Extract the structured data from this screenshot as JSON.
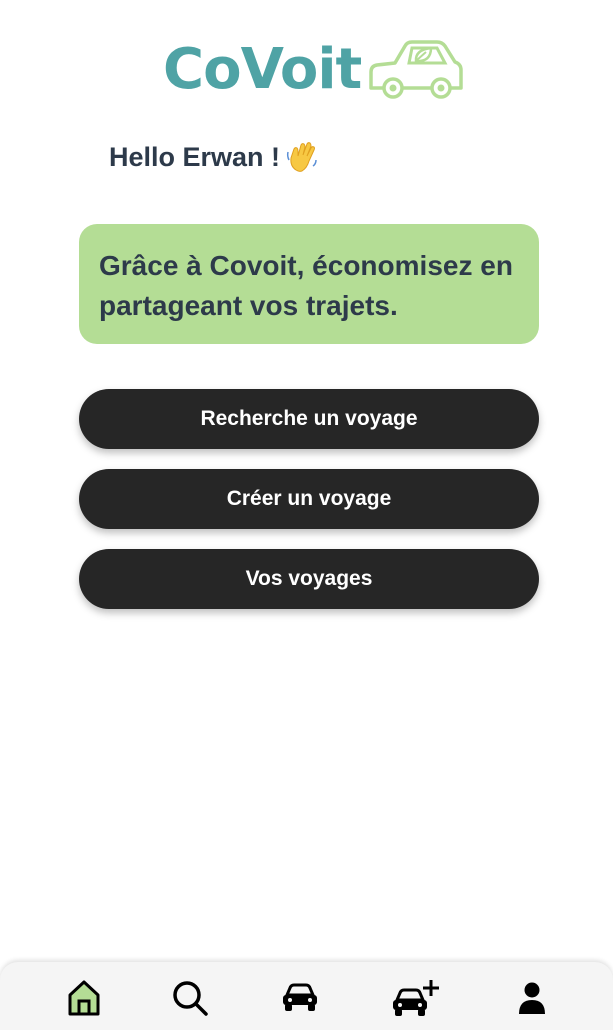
{
  "app": {
    "logo_text": "CoVoit",
    "brand_color": "#4fa3a5",
    "logo_car_color": "#b4dd95"
  },
  "greeting": {
    "text": "Hello Erwan !",
    "icon": "waving-hand-icon"
  },
  "promo": {
    "text": "Grâce à Covoit, économisez en partageant vos trajets.",
    "background": "#b4dd95"
  },
  "actions": {
    "search_trip": "Recherche un voyage",
    "create_trip": "Créer un voyage",
    "my_trips": "Vos voyages"
  },
  "bottom_nav": {
    "items": [
      {
        "icon": "home-icon",
        "active": true
      },
      {
        "icon": "search-icon",
        "active": false
      },
      {
        "icon": "car-icon",
        "active": false
      },
      {
        "icon": "car-add-icon",
        "active": false
      },
      {
        "icon": "user-icon",
        "active": false
      }
    ],
    "active_color": "#b4dd95"
  }
}
